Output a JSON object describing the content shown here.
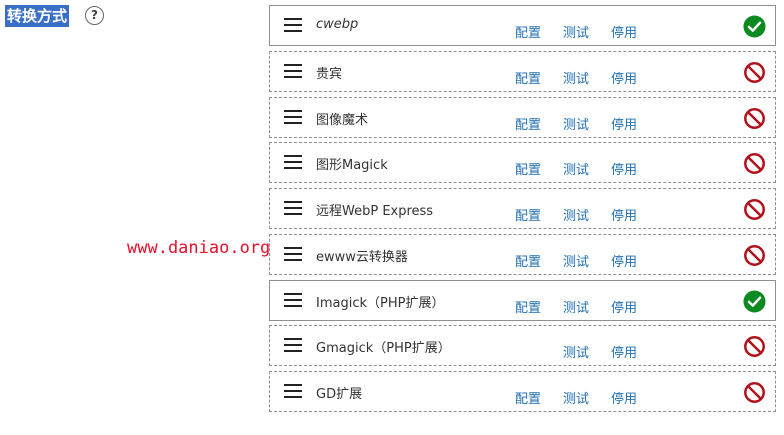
{
  "section": {
    "title": "转换方式",
    "help_label": "?"
  },
  "watermark": "www.daniao.org",
  "converters": [
    {
      "name": "cwebp",
      "italic": true,
      "config_label": "配置",
      "test_label": "测试",
      "disable_label": "停用",
      "status": "check-circle-icon"
    },
    {
      "name": "贵宾",
      "config_label": "配置",
      "test_label": "测试",
      "disable_label": "停用",
      "status": "prohibited-icon"
    },
    {
      "name": "图像魔术",
      "config_label": "配置",
      "test_label": "测试",
      "disable_label": "停用",
      "status": "prohibited-icon"
    },
    {
      "name": "图形Magick",
      "config_label": "配置",
      "test_label": "测试",
      "disable_label": "停用",
      "status": "prohibited-icon"
    },
    {
      "name": "远程WebP Express",
      "config_label": "配置",
      "test_label": "测试",
      "disable_label": "停用",
      "status": "prohibited-icon"
    },
    {
      "name": "ewww云转换器",
      "config_label": "配置",
      "test_label": "测试",
      "disable_label": "停用",
      "status": "prohibited-icon"
    },
    {
      "name": "Imagick（PHP扩展）",
      "config_label": "配置",
      "test_label": "测试",
      "disable_label": "停用",
      "status": "check-circle-icon"
    },
    {
      "name": "Gmagick（PHP扩展）",
      "test_label": "测试",
      "disable_label": "停用",
      "status": "prohibited-icon"
    },
    {
      "name": "GD扩展",
      "config_label": "配置",
      "test_label": "测试",
      "disable_label": "停用",
      "status": "prohibited-icon"
    }
  ],
  "colors": {
    "link": "#2271b1",
    "success": "#0b8a1f",
    "error": "#b0121b",
    "title_highlight": "#3a6fc7",
    "watermark": "#e8102a"
  }
}
